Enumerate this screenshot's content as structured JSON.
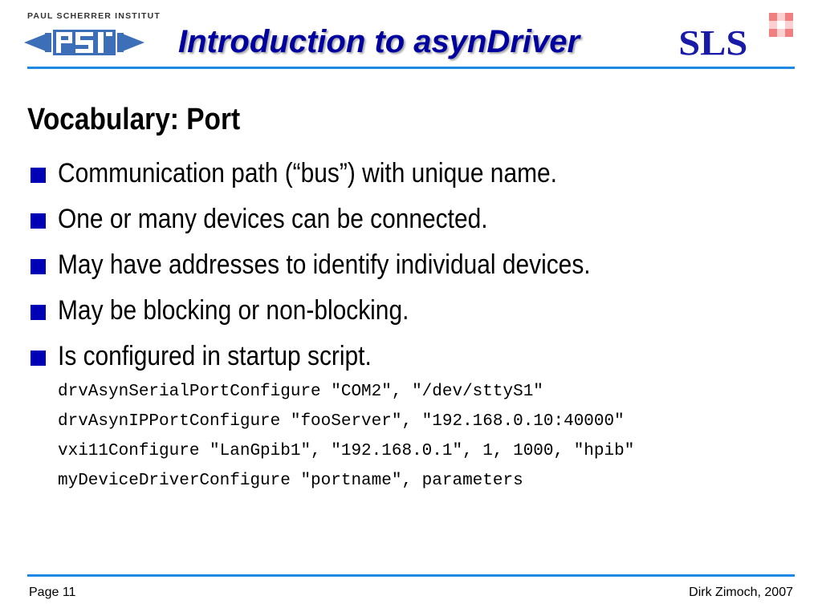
{
  "header": {
    "institute_name": "PAUL SCHERRER INSTITUT",
    "psi_logo_text": "PSI",
    "title": "Introduction to asynDriver",
    "sls_logo_text": "SLS"
  },
  "slide": {
    "subtitle": "Vocabulary: Port",
    "bullets": [
      "Communication path (“bus”) with unique name.",
      "One or many devices can be connected.",
      "May have addresses to identify individual devices.",
      "May be blocking or non-blocking.",
      "Is configured in startup script."
    ],
    "code_lines": [
      "drvAsynSerialPortConfigure \"COM2\", \"/dev/sttyS1\"",
      "drvAsynIPPortConfigure \"fooServer\", \"192.168.0.10:40000\"",
      "vxi11Configure \"LanGpib1\", \"192.168.0.1\", 1, 1000, \"hpib\"",
      "myDeviceDriverConfigure \"portname\", parameters"
    ]
  },
  "footer": {
    "page": "Page 11",
    "author": "Dirk Zimoch, 2007"
  },
  "colors": {
    "title": "#0000a0",
    "rule": "#1e88e5",
    "bullet": "#0000b4",
    "psi_blue": "#3d6fb8",
    "sls_blue": "#1a1aa8",
    "sls_pink": "#f08080"
  }
}
